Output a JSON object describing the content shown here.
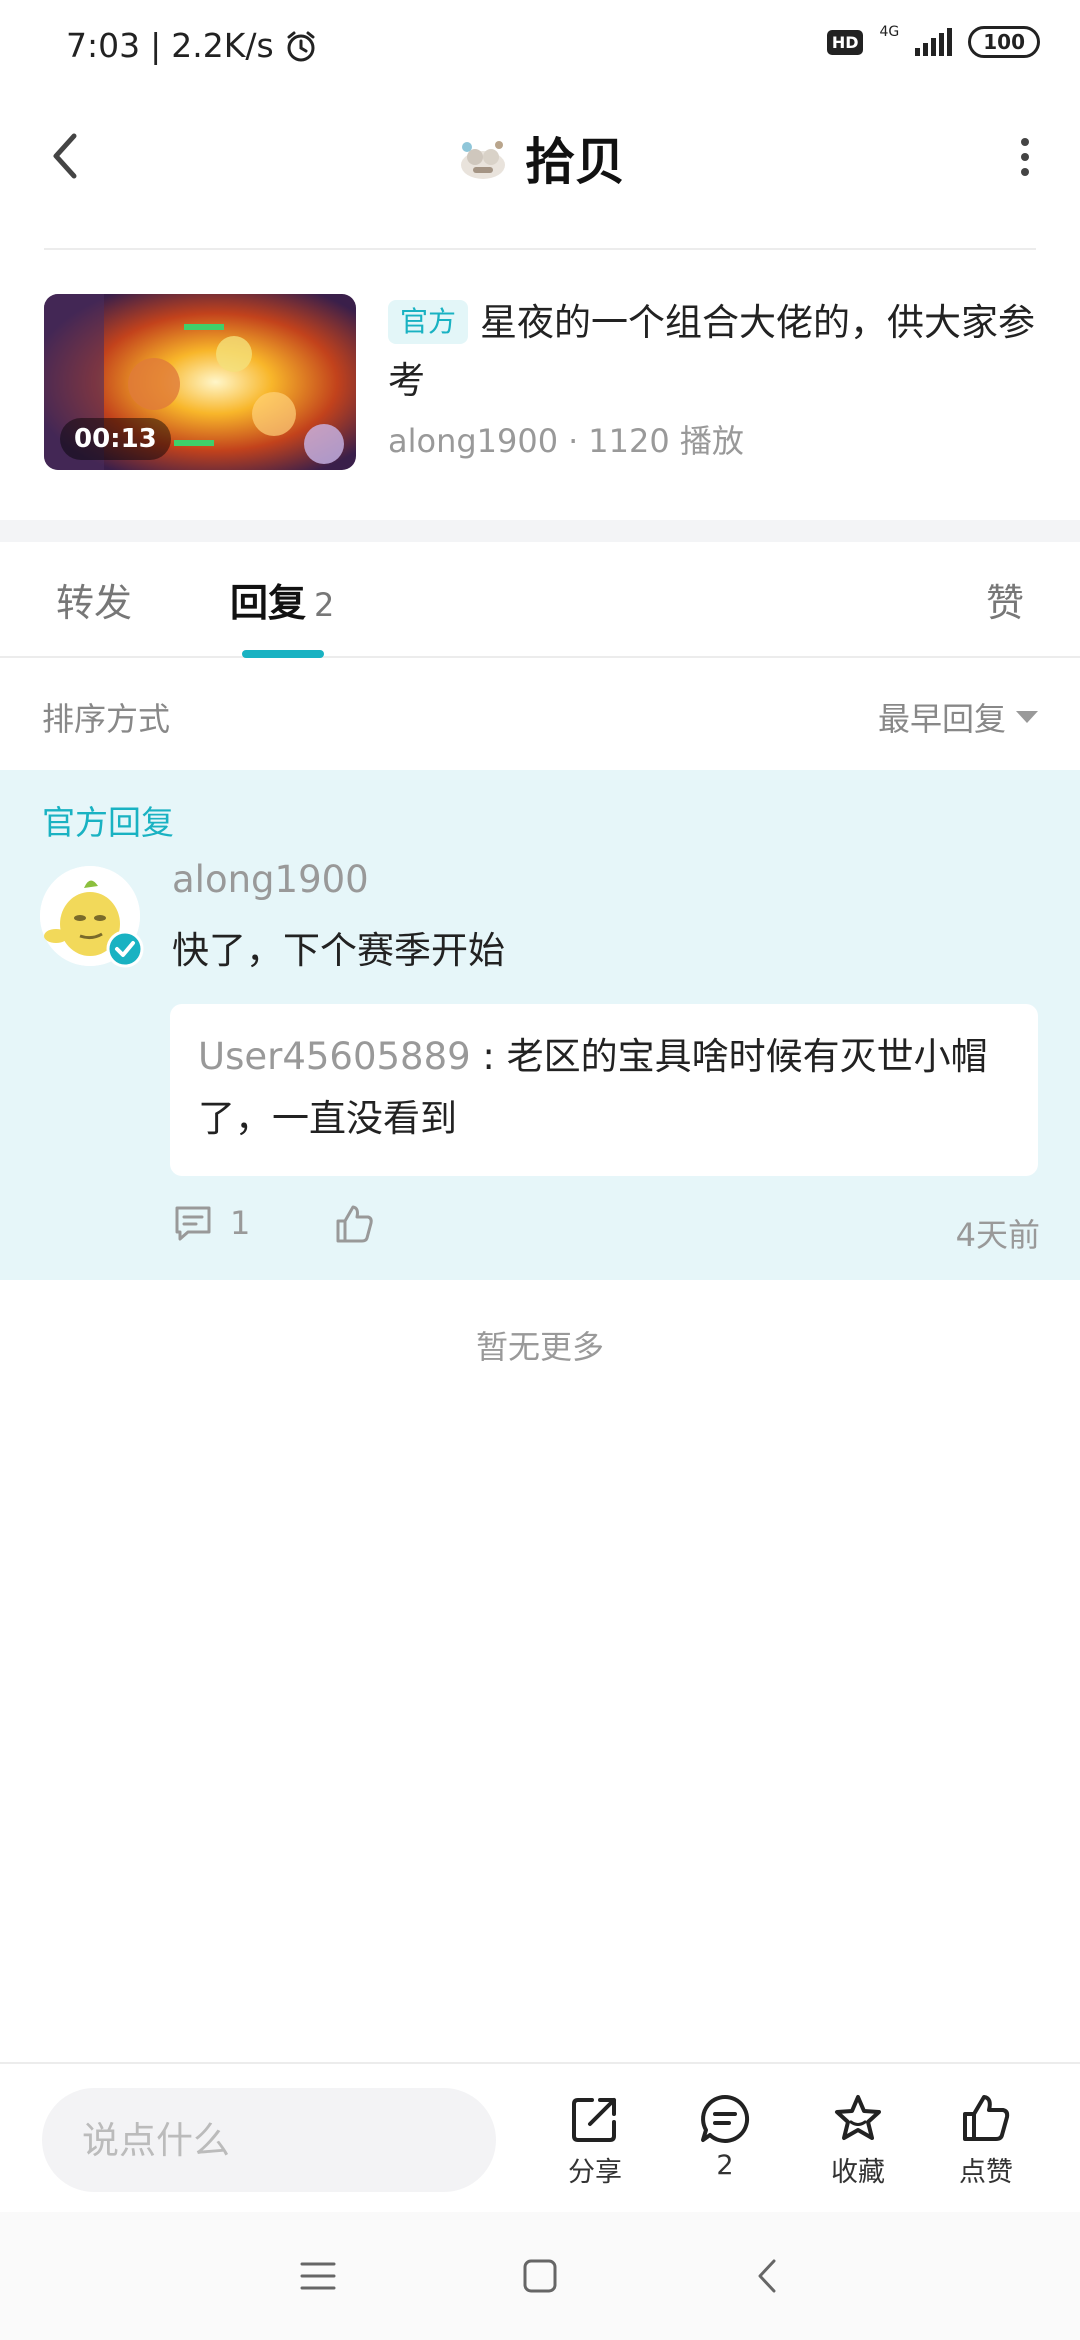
{
  "status_bar": {
    "time": "7:03",
    "separator": "|",
    "net_speed": "2.2K/s",
    "hd": "HD",
    "network": "4G",
    "battery": "100"
  },
  "header": {
    "title": "拾贝"
  },
  "post": {
    "badge": "官方",
    "title": "星夜的一个组合大佬的，供大家参考",
    "duration": "00:13",
    "author": "along1900",
    "dot": "·",
    "plays": "1120 播放"
  },
  "tabs": {
    "repost": "转发",
    "reply": "回复",
    "reply_count": "2",
    "like": "赞"
  },
  "sort": {
    "label": "排序方式",
    "value": "最早回复"
  },
  "official_reply": {
    "section_label": "官方回复",
    "author": "along1900",
    "text": "快了，下个赛季开始",
    "quote_user": "User45605889",
    "quote_sep": " : ",
    "quote_text": "老区的宝具啥时候有灭世小帽了，一直没看到",
    "comment_count": "1",
    "time": "4天前"
  },
  "no_more": "暂无更多",
  "bottom_bar": {
    "input_placeholder": "说点什么",
    "share": "分享",
    "comments": "2",
    "collect": "收藏",
    "like": "点赞"
  },
  "colors": {
    "accent": "#19b2c2",
    "reply_bg": "#e6f6f9"
  }
}
